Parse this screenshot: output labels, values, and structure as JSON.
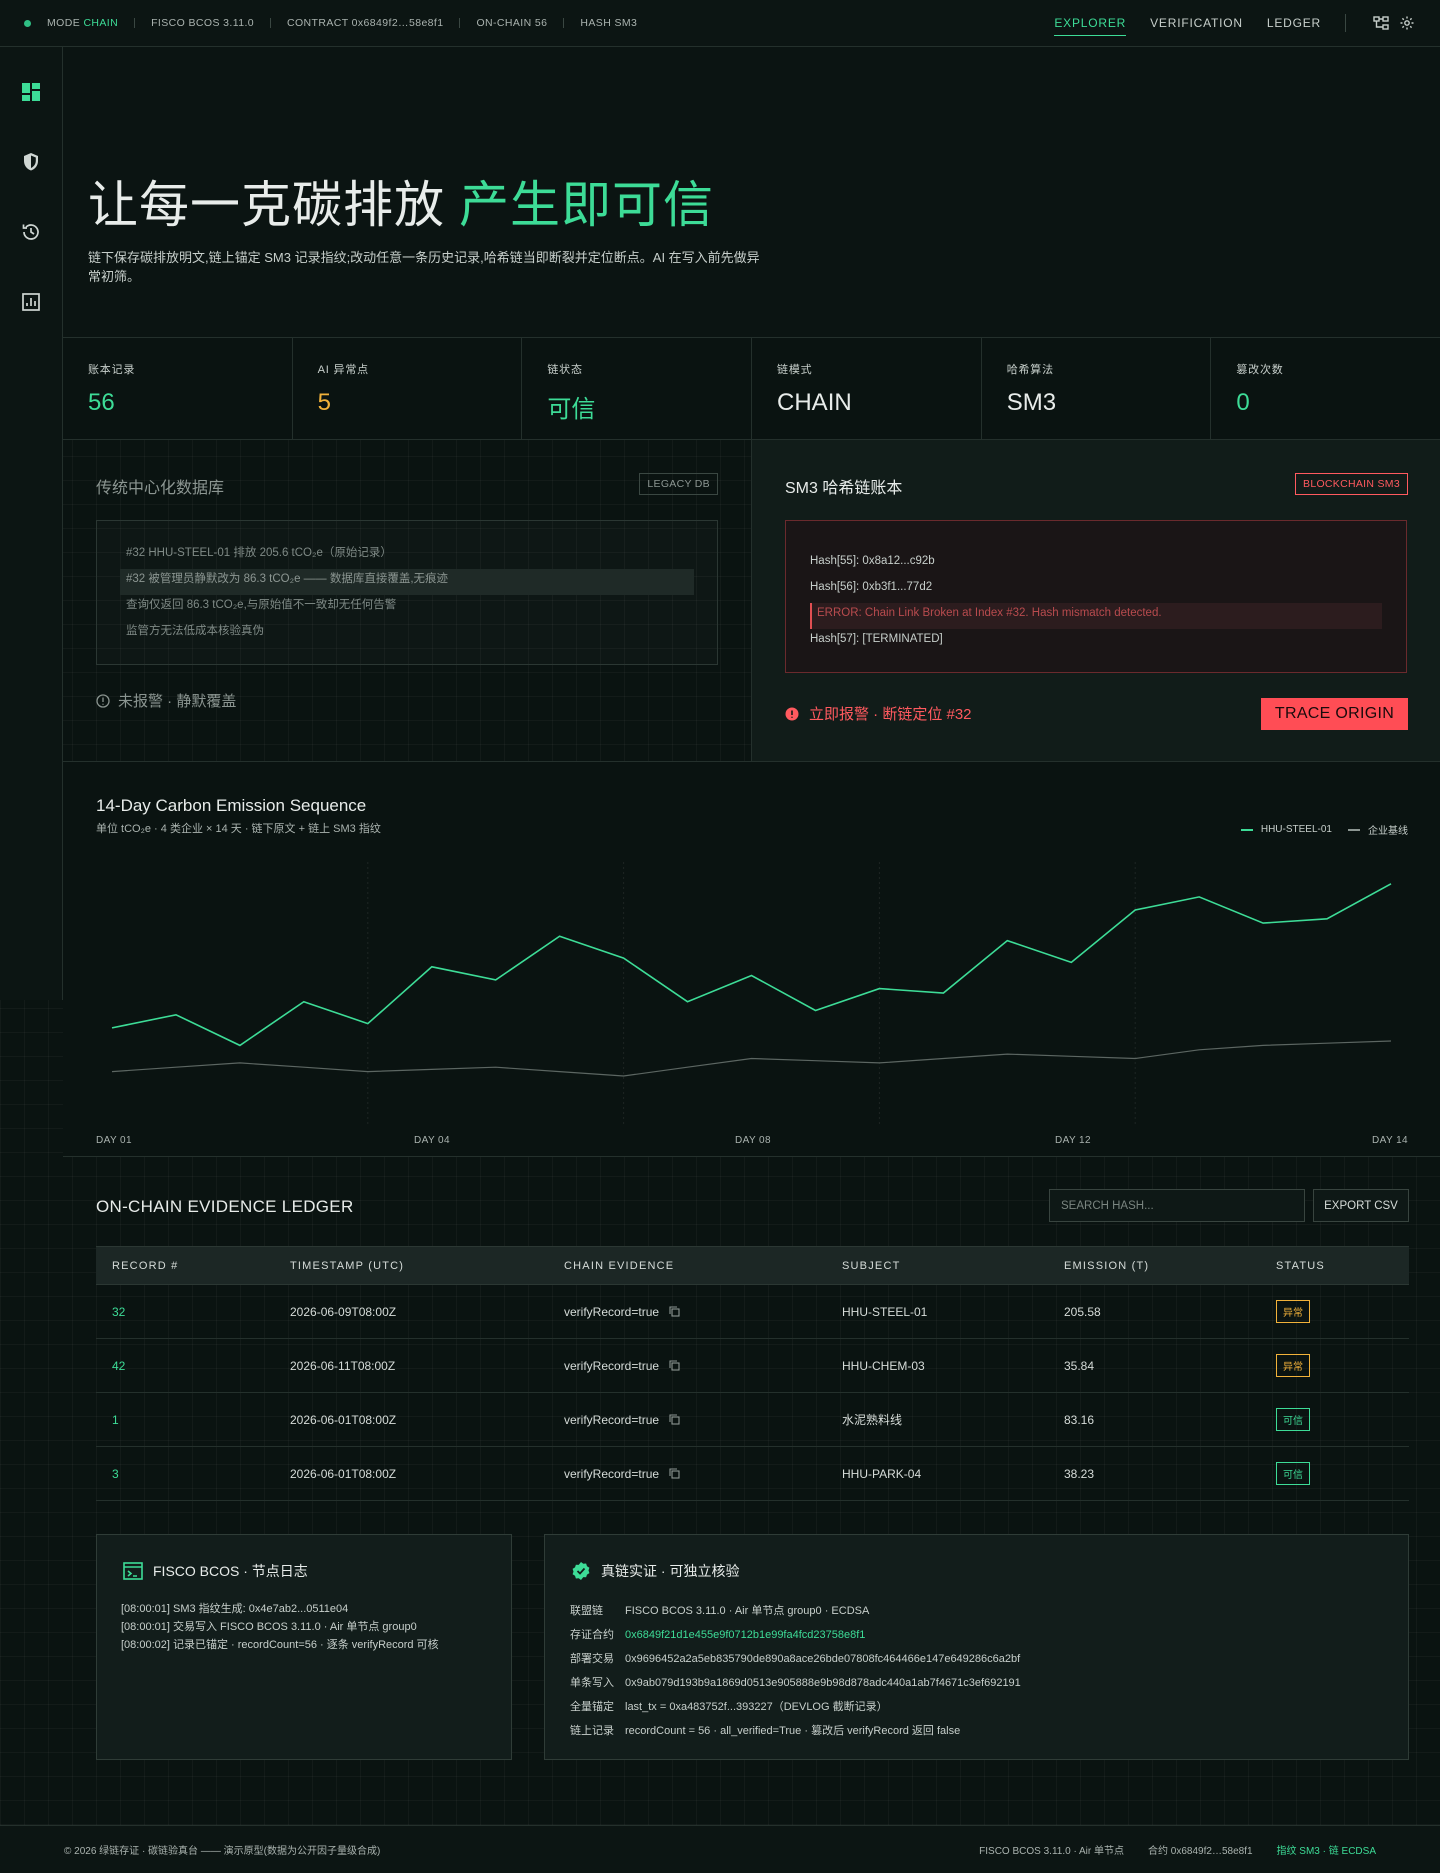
{
  "topbar": {
    "mode_label": "MODE",
    "mode_value": "CHAIN",
    "version": "FISCO BCOS 3.11.0",
    "contract": "CONTRACT 0x6849f2…58e8f1",
    "onchain": "ON-CHAIN 56",
    "hash": "HASH SM3",
    "nav": [
      "EXPLORER",
      "VERIFICATION",
      "LEDGER"
    ]
  },
  "hero": {
    "title_main": "让每一克碳排放",
    "title_accent": "产生即可信",
    "description": "链下保存碳排放明文,链上锚定 SM3 记录指纹;改动任意一条历史记录,哈希链当即断裂并定位断点。AI 在写入前先做异常初筛。"
  },
  "stats": [
    {
      "label": "账本记录",
      "value": "56",
      "color": "#3ddc97"
    },
    {
      "label": "AI 异常点",
      "value": "5",
      "color": "#f2b23a"
    },
    {
      "label": "链状态",
      "value": "可信",
      "color": "#3ddc97"
    },
    {
      "label": "链模式",
      "value": "CHAIN",
      "color": "#e8ecea"
    },
    {
      "label": "哈希算法",
      "value": "SM3",
      "color": "#e8ecea"
    },
    {
      "label": "篡改次数",
      "value": "0",
      "color": "#3ddc97"
    }
  ],
  "legacy": {
    "title": "传统中心化数据库",
    "tag": "LEGACY DB",
    "lines": [
      "#32 HHU-STEEL-01 排放 205.6 tCO₂e（原始记录）",
      "#32 被管理员静默改为 86.3 tCO₂e —— 数据库直接覆盖,无痕迹",
      "查询仅返回 86.3 tCO₂e,与原始值不一致却无任何告警",
      "监管方无法低成本核验真伪"
    ],
    "warning": "未报警 · 静默覆盖"
  },
  "chain": {
    "title": "SM3 哈希链账本",
    "tag": "BLOCKCHAIN SM3",
    "lines": [
      "Hash[55]: 0x8a12...c92b",
      "Hash[56]: 0xb3f1...77d2",
      "ERROR: Chain Link Broken at Index #32. Hash mismatch detected.",
      "Hash[57]: [TERMINATED]"
    ],
    "alarm": "立即报警 · 断链定位 #32",
    "trace_button": "TRACE ORIGIN"
  },
  "chart_data": {
    "type": "line",
    "title": "14-Day Carbon Emission Sequence",
    "subtitle": "单位 tCO₂e · 4 类企业 × 14 天 · 链下原文 + 链上 SM3 指纹",
    "x_labels": [
      "DAY 01",
      "DAY 04",
      "DAY 08",
      "DAY 12",
      "DAY 14"
    ],
    "grid": true,
    "legend_position": "top-right",
    "series": [
      {
        "name": "HHU-STEEL-01",
        "color": "#3ddc97",
        "values": [
          62,
          65,
          58,
          68,
          63,
          76,
          73,
          83,
          78,
          68,
          74,
          66,
          71,
          70,
          82,
          77,
          89,
          92,
          86,
          87,
          95
        ]
      },
      {
        "name": "企业基线",
        "color": "#5c6662",
        "values": [
          52,
          53,
          54,
          53,
          52,
          52.5,
          53,
          52,
          51,
          53,
          55,
          54.5,
          54,
          55,
          56,
          55.5,
          55,
          57,
          58,
          58.5,
          59
        ]
      }
    ],
    "ylim": [
      40,
      100
    ]
  },
  "ledger": {
    "title": "ON-CHAIN EVIDENCE LEDGER",
    "search_placeholder": "SEARCH HASH...",
    "export_label": "EXPORT CSV",
    "columns": [
      "RECORD #",
      "TIMESTAMP (UTC)",
      "CHAIN EVIDENCE",
      "SUBJECT",
      "EMISSION (T)",
      "STATUS"
    ],
    "rows": [
      {
        "record": "32",
        "timestamp": "2026-06-09T08:00Z",
        "evidence": "verifyRecord=true",
        "subject": "HHU-STEEL-01",
        "emission": "205.58",
        "status": "异常",
        "status_color": "#f2b23a"
      },
      {
        "record": "42",
        "timestamp": "2026-06-11T08:00Z",
        "evidence": "verifyRecord=true",
        "subject": "HHU-CHEM-03",
        "emission": "35.84",
        "status": "异常",
        "status_color": "#f2b23a"
      },
      {
        "record": "1",
        "timestamp": "2026-06-01T08:00Z",
        "evidence": "verifyRecord=true",
        "subject": "水泥熟料线",
        "emission": "83.16",
        "status": "可信",
        "status_color": "#3ddc97"
      },
      {
        "record": "3",
        "timestamp": "2026-06-01T08:00Z",
        "evidence": "verifyRecord=true",
        "subject": "HHU-PARK-04",
        "emission": "38.23",
        "status": "可信",
        "status_color": "#3ddc97"
      }
    ]
  },
  "node_log": {
    "title": "FISCO BCOS · 节点日志",
    "lines": [
      "[08:00:01] SM3 指纹生成: 0x4e7ab2...0511e04",
      "[08:00:01] 交易写入 FISCO BCOS 3.11.0 · Air 单节点 group0",
      "[08:00:02] 记录已锚定 · recordCount=56 · 逐条 verifyRecord 可核"
    ]
  },
  "verify": {
    "title": "真链实证 · 可独立核验",
    "rows": [
      {
        "k": "联盟链",
        "v": "FISCO BCOS 3.11.0 · Air 单节点 group0 · ECDSA",
        "green": false
      },
      {
        "k": "存证合约",
        "v": "0x6849f21d1e455e9f0712b1e99fa4fcd23758e8f1",
        "green": true
      },
      {
        "k": "部署交易",
        "v": "0x9696452a2a5eb835790de890a8ace26bde07808fc464466e147e649286c6a2bf",
        "green": false
      },
      {
        "k": "单条写入",
        "v": "0x9ab079d193b9a1869d0513e905888e9b98d878adc440a1ab7f4671c3ef692191",
        "green": false
      },
      {
        "k": "全量锚定",
        "v": "last_tx = 0xa483752f...393227（DEVLOG 截断记录）",
        "green": false
      },
      {
        "k": "链上记录",
        "v": "recordCount = 56 · all_verified=True · 篡改后 verifyRecord 返回 false",
        "green": false
      }
    ]
  },
  "footer": {
    "left": "© 2026 绿链存证 · 碳链验真台 —— 演示原型(数据为公开因子量级合成)",
    "right1": "FISCO BCOS 3.11.0 · Air 单节点",
    "right2": "合约 0x6849f2…58e8f1",
    "right3": "指纹 SM3 · 链 ECDSA"
  }
}
